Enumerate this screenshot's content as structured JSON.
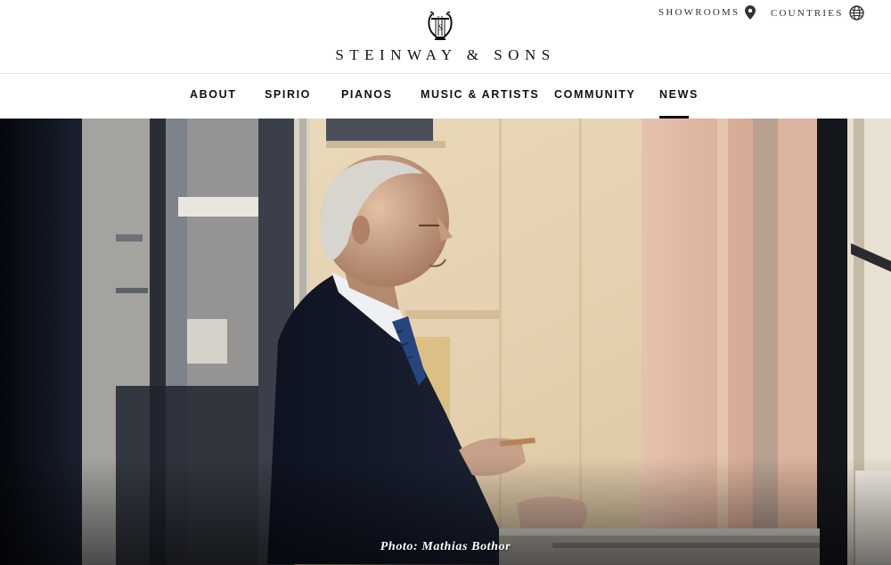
{
  "header": {
    "brand": "STEINWAY & SONS",
    "utility": [
      {
        "label": "SHOWROOMS",
        "icon": "location-pin-icon"
      },
      {
        "label": "COUNTRIES",
        "icon": "globe-icon"
      }
    ]
  },
  "nav": {
    "items": [
      {
        "label": "ABOUT"
      },
      {
        "label": "SPIRIO"
      },
      {
        "label": "PIANOS"
      },
      {
        "label": "MUSIC & ARTISTS"
      },
      {
        "label": "COMMUNITY"
      },
      {
        "label": "NEWS",
        "active": true
      }
    ]
  },
  "hero": {
    "caption": "Photo: Mathias Bothor"
  },
  "colors": {
    "text": "#111111",
    "wall": "#e9d6b6",
    "pink_wall": "#e0b9a4",
    "suit": "#151b2c"
  }
}
